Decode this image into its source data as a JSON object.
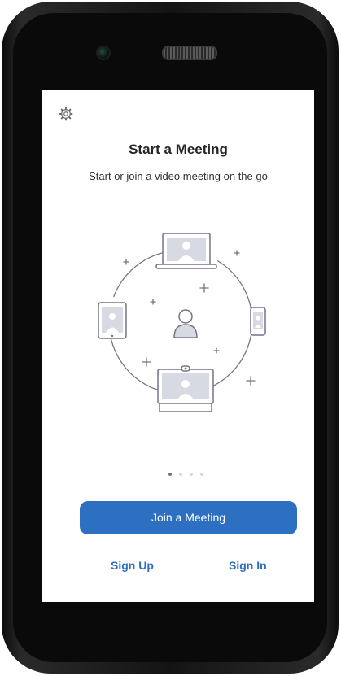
{
  "screen": {
    "title": "Start a Meeting",
    "subtitle": "Start or join a video meeting on the go",
    "pager": {
      "count": 4,
      "active": 1
    },
    "join_button": "Join a Meeting",
    "sign_up": "Sign Up",
    "sign_in": "Sign In"
  },
  "icons": {
    "settings": "gear-icon",
    "illustration": "devices-circle-illustration"
  },
  "colors": {
    "accent": "#2d6fc1",
    "text": "#25262b",
    "illustration_stroke": "#747487",
    "illustration_fill": "#d7d9e3"
  }
}
